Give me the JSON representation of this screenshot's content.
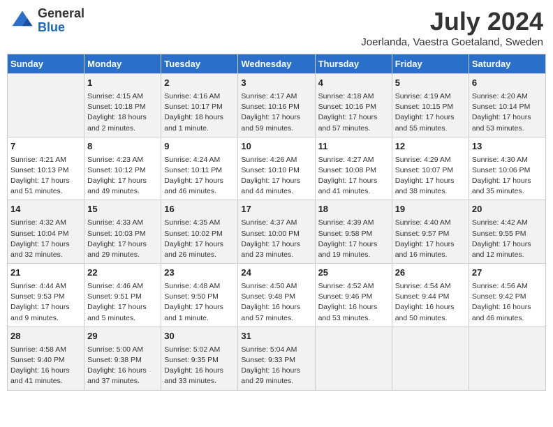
{
  "header": {
    "logo_general": "General",
    "logo_blue": "Blue",
    "month": "July 2024",
    "location": "Joerlanda, Vaestra Goetaland, Sweden"
  },
  "weekdays": [
    "Sunday",
    "Monday",
    "Tuesday",
    "Wednesday",
    "Thursday",
    "Friday",
    "Saturday"
  ],
  "weeks": [
    [
      {
        "day": "",
        "info": ""
      },
      {
        "day": "1",
        "info": "Sunrise: 4:15 AM\nSunset: 10:18 PM\nDaylight: 18 hours\nand 2 minutes."
      },
      {
        "day": "2",
        "info": "Sunrise: 4:16 AM\nSunset: 10:17 PM\nDaylight: 18 hours\nand 1 minute."
      },
      {
        "day": "3",
        "info": "Sunrise: 4:17 AM\nSunset: 10:16 PM\nDaylight: 17 hours\nand 59 minutes."
      },
      {
        "day": "4",
        "info": "Sunrise: 4:18 AM\nSunset: 10:16 PM\nDaylight: 17 hours\nand 57 minutes."
      },
      {
        "day": "5",
        "info": "Sunrise: 4:19 AM\nSunset: 10:15 PM\nDaylight: 17 hours\nand 55 minutes."
      },
      {
        "day": "6",
        "info": "Sunrise: 4:20 AM\nSunset: 10:14 PM\nDaylight: 17 hours\nand 53 minutes."
      }
    ],
    [
      {
        "day": "7",
        "info": "Sunrise: 4:21 AM\nSunset: 10:13 PM\nDaylight: 17 hours\nand 51 minutes."
      },
      {
        "day": "8",
        "info": "Sunrise: 4:23 AM\nSunset: 10:12 PM\nDaylight: 17 hours\nand 49 minutes."
      },
      {
        "day": "9",
        "info": "Sunrise: 4:24 AM\nSunset: 10:11 PM\nDaylight: 17 hours\nand 46 minutes."
      },
      {
        "day": "10",
        "info": "Sunrise: 4:26 AM\nSunset: 10:10 PM\nDaylight: 17 hours\nand 44 minutes."
      },
      {
        "day": "11",
        "info": "Sunrise: 4:27 AM\nSunset: 10:08 PM\nDaylight: 17 hours\nand 41 minutes."
      },
      {
        "day": "12",
        "info": "Sunrise: 4:29 AM\nSunset: 10:07 PM\nDaylight: 17 hours\nand 38 minutes."
      },
      {
        "day": "13",
        "info": "Sunrise: 4:30 AM\nSunset: 10:06 PM\nDaylight: 17 hours\nand 35 minutes."
      }
    ],
    [
      {
        "day": "14",
        "info": "Sunrise: 4:32 AM\nSunset: 10:04 PM\nDaylight: 17 hours\nand 32 minutes."
      },
      {
        "day": "15",
        "info": "Sunrise: 4:33 AM\nSunset: 10:03 PM\nDaylight: 17 hours\nand 29 minutes."
      },
      {
        "day": "16",
        "info": "Sunrise: 4:35 AM\nSunset: 10:02 PM\nDaylight: 17 hours\nand 26 minutes."
      },
      {
        "day": "17",
        "info": "Sunrise: 4:37 AM\nSunset: 10:00 PM\nDaylight: 17 hours\nand 23 minutes."
      },
      {
        "day": "18",
        "info": "Sunrise: 4:39 AM\nSunset: 9:58 PM\nDaylight: 17 hours\nand 19 minutes."
      },
      {
        "day": "19",
        "info": "Sunrise: 4:40 AM\nSunset: 9:57 PM\nDaylight: 17 hours\nand 16 minutes."
      },
      {
        "day": "20",
        "info": "Sunrise: 4:42 AM\nSunset: 9:55 PM\nDaylight: 17 hours\nand 12 minutes."
      }
    ],
    [
      {
        "day": "21",
        "info": "Sunrise: 4:44 AM\nSunset: 9:53 PM\nDaylight: 17 hours\nand 9 minutes."
      },
      {
        "day": "22",
        "info": "Sunrise: 4:46 AM\nSunset: 9:51 PM\nDaylight: 17 hours\nand 5 minutes."
      },
      {
        "day": "23",
        "info": "Sunrise: 4:48 AM\nSunset: 9:50 PM\nDaylight: 17 hours\nand 1 minute."
      },
      {
        "day": "24",
        "info": "Sunrise: 4:50 AM\nSunset: 9:48 PM\nDaylight: 16 hours\nand 57 minutes."
      },
      {
        "day": "25",
        "info": "Sunrise: 4:52 AM\nSunset: 9:46 PM\nDaylight: 16 hours\nand 53 minutes."
      },
      {
        "day": "26",
        "info": "Sunrise: 4:54 AM\nSunset: 9:44 PM\nDaylight: 16 hours\nand 50 minutes."
      },
      {
        "day": "27",
        "info": "Sunrise: 4:56 AM\nSunset: 9:42 PM\nDaylight: 16 hours\nand 46 minutes."
      }
    ],
    [
      {
        "day": "28",
        "info": "Sunrise: 4:58 AM\nSunset: 9:40 PM\nDaylight: 16 hours\nand 41 minutes."
      },
      {
        "day": "29",
        "info": "Sunrise: 5:00 AM\nSunset: 9:38 PM\nDaylight: 16 hours\nand 37 minutes."
      },
      {
        "day": "30",
        "info": "Sunrise: 5:02 AM\nSunset: 9:35 PM\nDaylight: 16 hours\nand 33 minutes."
      },
      {
        "day": "31",
        "info": "Sunrise: 5:04 AM\nSunset: 9:33 PM\nDaylight: 16 hours\nand 29 minutes."
      },
      {
        "day": "",
        "info": ""
      },
      {
        "day": "",
        "info": ""
      },
      {
        "day": "",
        "info": ""
      }
    ]
  ]
}
